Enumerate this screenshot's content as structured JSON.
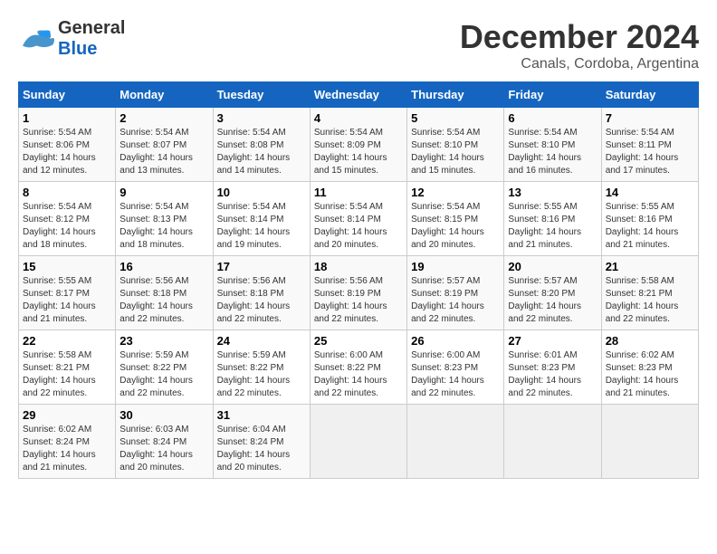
{
  "header": {
    "logo_general": "General",
    "logo_blue": "Blue",
    "title": "December 2024",
    "subtitle": "Canals, Cordoba, Argentina"
  },
  "calendar": {
    "days_of_week": [
      "Sunday",
      "Monday",
      "Tuesday",
      "Wednesday",
      "Thursday",
      "Friday",
      "Saturday"
    ],
    "weeks": [
      [
        {
          "day": "1",
          "info": "Sunrise: 5:54 AM\nSunset: 8:06 PM\nDaylight: 14 hours\nand 12 minutes."
        },
        {
          "day": "2",
          "info": "Sunrise: 5:54 AM\nSunset: 8:07 PM\nDaylight: 14 hours\nand 13 minutes."
        },
        {
          "day": "3",
          "info": "Sunrise: 5:54 AM\nSunset: 8:08 PM\nDaylight: 14 hours\nand 14 minutes."
        },
        {
          "day": "4",
          "info": "Sunrise: 5:54 AM\nSunset: 8:09 PM\nDaylight: 14 hours\nand 15 minutes."
        },
        {
          "day": "5",
          "info": "Sunrise: 5:54 AM\nSunset: 8:10 PM\nDaylight: 14 hours\nand 15 minutes."
        },
        {
          "day": "6",
          "info": "Sunrise: 5:54 AM\nSunset: 8:10 PM\nDaylight: 14 hours\nand 16 minutes."
        },
        {
          "day": "7",
          "info": "Sunrise: 5:54 AM\nSunset: 8:11 PM\nDaylight: 14 hours\nand 17 minutes."
        }
      ],
      [
        {
          "day": "8",
          "info": "Sunrise: 5:54 AM\nSunset: 8:12 PM\nDaylight: 14 hours\nand 18 minutes."
        },
        {
          "day": "9",
          "info": "Sunrise: 5:54 AM\nSunset: 8:13 PM\nDaylight: 14 hours\nand 18 minutes."
        },
        {
          "day": "10",
          "info": "Sunrise: 5:54 AM\nSunset: 8:14 PM\nDaylight: 14 hours\nand 19 minutes."
        },
        {
          "day": "11",
          "info": "Sunrise: 5:54 AM\nSunset: 8:14 PM\nDaylight: 14 hours\nand 20 minutes."
        },
        {
          "day": "12",
          "info": "Sunrise: 5:54 AM\nSunset: 8:15 PM\nDaylight: 14 hours\nand 20 minutes."
        },
        {
          "day": "13",
          "info": "Sunrise: 5:55 AM\nSunset: 8:16 PM\nDaylight: 14 hours\nand 21 minutes."
        },
        {
          "day": "14",
          "info": "Sunrise: 5:55 AM\nSunset: 8:16 PM\nDaylight: 14 hours\nand 21 minutes."
        }
      ],
      [
        {
          "day": "15",
          "info": "Sunrise: 5:55 AM\nSunset: 8:17 PM\nDaylight: 14 hours\nand 21 minutes."
        },
        {
          "day": "16",
          "info": "Sunrise: 5:56 AM\nSunset: 8:18 PM\nDaylight: 14 hours\nand 22 minutes."
        },
        {
          "day": "17",
          "info": "Sunrise: 5:56 AM\nSunset: 8:18 PM\nDaylight: 14 hours\nand 22 minutes."
        },
        {
          "day": "18",
          "info": "Sunrise: 5:56 AM\nSunset: 8:19 PM\nDaylight: 14 hours\nand 22 minutes."
        },
        {
          "day": "19",
          "info": "Sunrise: 5:57 AM\nSunset: 8:19 PM\nDaylight: 14 hours\nand 22 minutes."
        },
        {
          "day": "20",
          "info": "Sunrise: 5:57 AM\nSunset: 8:20 PM\nDaylight: 14 hours\nand 22 minutes."
        },
        {
          "day": "21",
          "info": "Sunrise: 5:58 AM\nSunset: 8:21 PM\nDaylight: 14 hours\nand 22 minutes."
        }
      ],
      [
        {
          "day": "22",
          "info": "Sunrise: 5:58 AM\nSunset: 8:21 PM\nDaylight: 14 hours\nand 22 minutes."
        },
        {
          "day": "23",
          "info": "Sunrise: 5:59 AM\nSunset: 8:22 PM\nDaylight: 14 hours\nand 22 minutes."
        },
        {
          "day": "24",
          "info": "Sunrise: 5:59 AM\nSunset: 8:22 PM\nDaylight: 14 hours\nand 22 minutes."
        },
        {
          "day": "25",
          "info": "Sunrise: 6:00 AM\nSunset: 8:22 PM\nDaylight: 14 hours\nand 22 minutes."
        },
        {
          "day": "26",
          "info": "Sunrise: 6:00 AM\nSunset: 8:23 PM\nDaylight: 14 hours\nand 22 minutes."
        },
        {
          "day": "27",
          "info": "Sunrise: 6:01 AM\nSunset: 8:23 PM\nDaylight: 14 hours\nand 22 minutes."
        },
        {
          "day": "28",
          "info": "Sunrise: 6:02 AM\nSunset: 8:23 PM\nDaylight: 14 hours\nand 21 minutes."
        }
      ],
      [
        {
          "day": "29",
          "info": "Sunrise: 6:02 AM\nSunset: 8:24 PM\nDaylight: 14 hours\nand 21 minutes."
        },
        {
          "day": "30",
          "info": "Sunrise: 6:03 AM\nSunset: 8:24 PM\nDaylight: 14 hours\nand 20 minutes."
        },
        {
          "day": "31",
          "info": "Sunrise: 6:04 AM\nSunset: 8:24 PM\nDaylight: 14 hours\nand 20 minutes."
        },
        {
          "day": "",
          "info": ""
        },
        {
          "day": "",
          "info": ""
        },
        {
          "day": "",
          "info": ""
        },
        {
          "day": "",
          "info": ""
        }
      ]
    ]
  }
}
